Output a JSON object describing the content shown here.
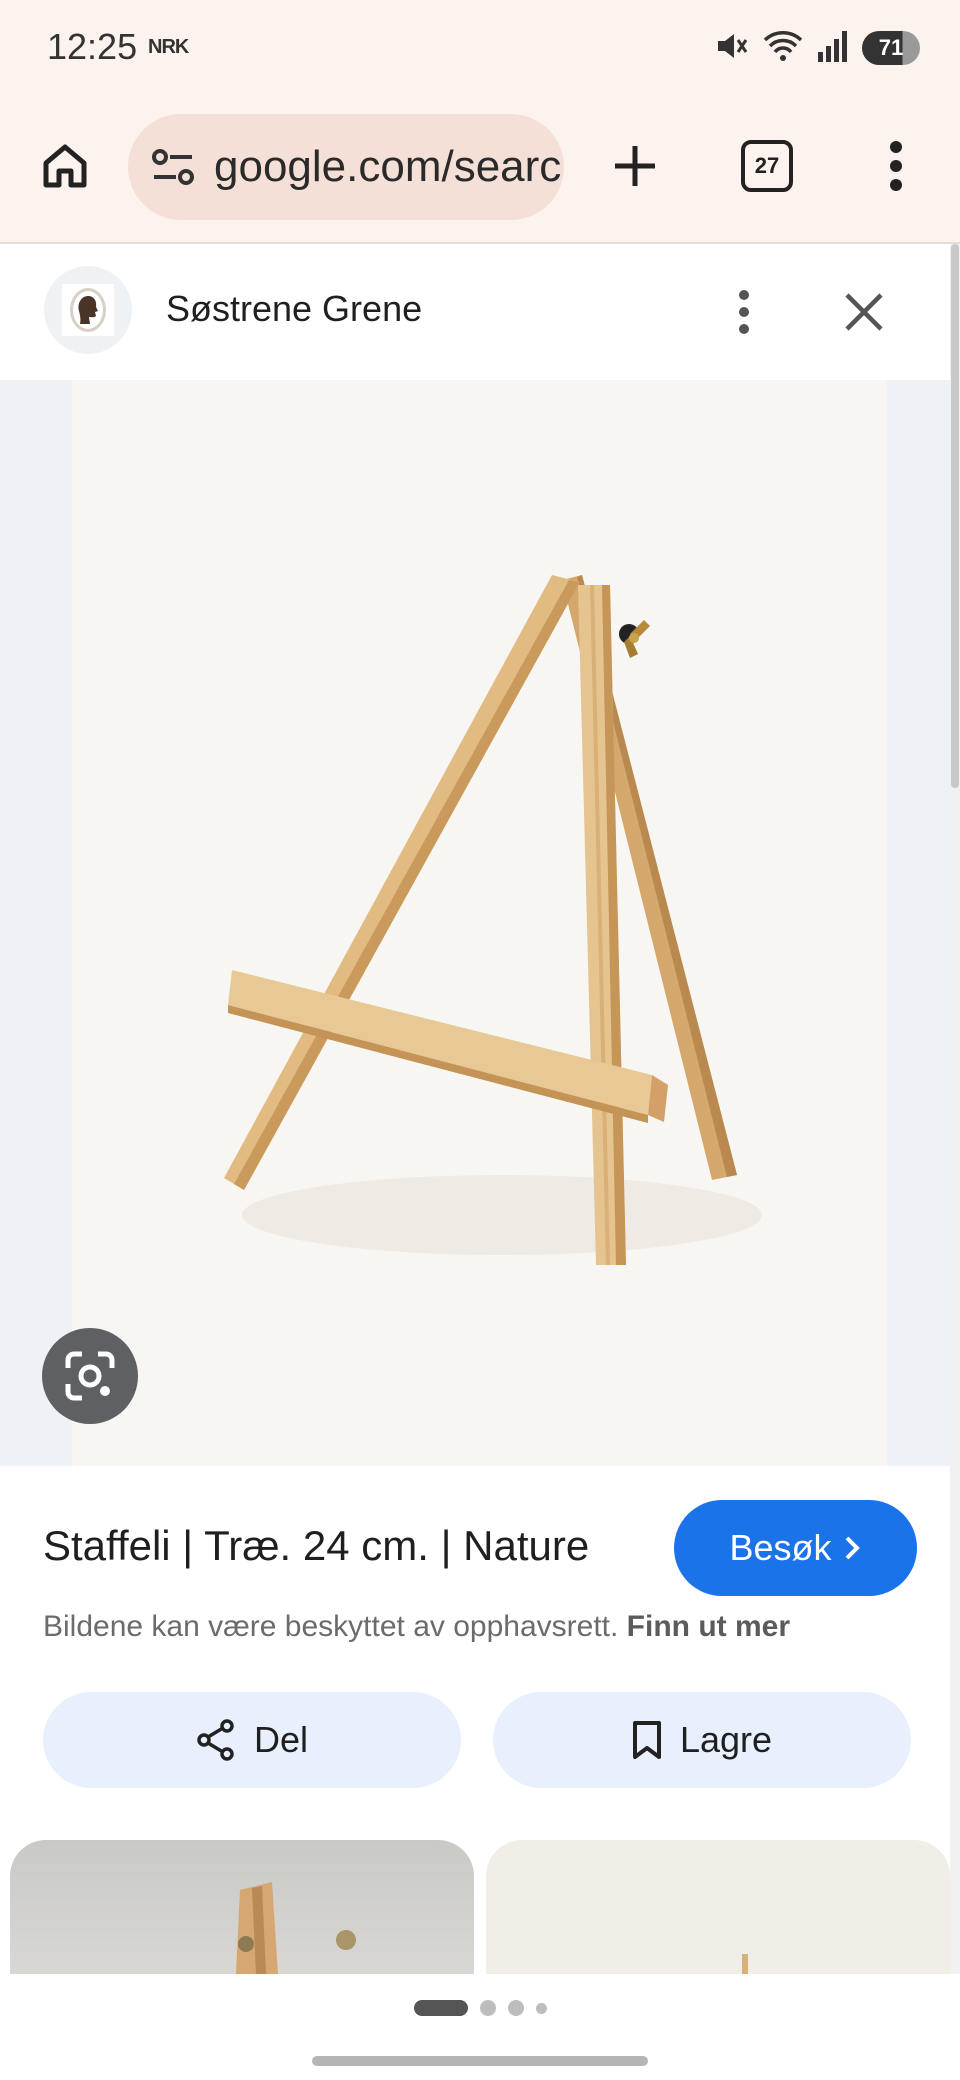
{
  "status_bar": {
    "time": "12:25",
    "app_badge": "NRK",
    "battery_level": "71",
    "icons": [
      "mute-icon",
      "wifi-icon",
      "signal-icon",
      "battery-icon"
    ]
  },
  "browser": {
    "url": "google.com/search",
    "tab_count": "27",
    "icons": [
      "home-icon",
      "site-settings-icon",
      "new-tab-icon",
      "tab-switcher-icon",
      "menu-icon"
    ]
  },
  "source": {
    "name": "Søstrene Grene",
    "icons": [
      "more-vert-icon",
      "close-icon"
    ]
  },
  "image": {
    "alt": "Wooden easel",
    "lens_icon": "google-lens-icon"
  },
  "info": {
    "title": "Staffeli | Træ. 24 cm. | Nature",
    "visit_label": "Besøk",
    "copyright_text": "Bildene kan være beskyttet av opphavsrett.",
    "copyright_link": "Finn ut mer",
    "share_label": "Del",
    "save_label": "Lagre"
  },
  "pager": {
    "active_index": 0,
    "count": 4
  },
  "colors": {
    "accent": "#1a73e8",
    "chip_background": "#e8f0fe",
    "toolbar_background": "#fcf3ee",
    "url_background": "#f5e0d7"
  }
}
